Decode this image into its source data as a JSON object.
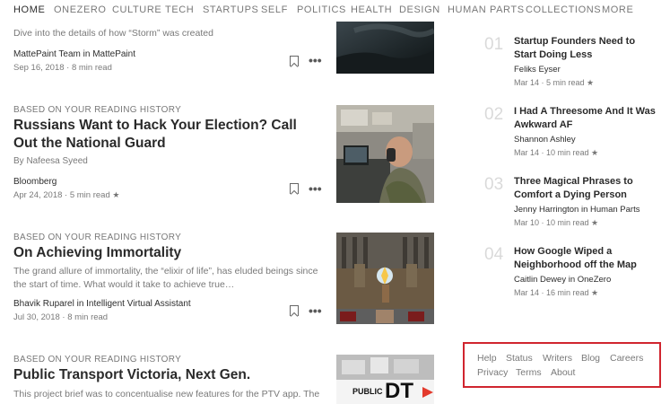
{
  "nav": {
    "items": [
      "HOME",
      "ONEZERO",
      "CULTURE",
      "TECH",
      "STARTUPS",
      "SELF",
      "POLITICS",
      "HEALTH",
      "DESIGN",
      "HUMAN PARTS",
      "COLLECTIONS",
      "MORE"
    ],
    "active": "HOME"
  },
  "feed": {
    "post0": {
      "excerpt": "Dive into the details of how “Storm” was created",
      "publisher": "MattePaint Team in MattePaint",
      "meta": "Sep 16, 2018 · 8 min read"
    },
    "post1": {
      "context": "BASED ON YOUR READING HISTORY",
      "title": "Russians Want to Hack Your Election? Call Out the National Guard",
      "byline": "By Nafeesa Syeed",
      "publisher": "Bloomberg",
      "meta": "Apr 24, 2018 · 5 min read",
      "star": "★"
    },
    "post2": {
      "context": "BASED ON YOUR READING HISTORY",
      "title": "On Achieving Immortality",
      "excerpt": "The grand allure of immortality, the “elixir of life”, has eluded beings since the start of time. What would it take to achieve true…",
      "publisher": "Bhavik Ruparel in Intelligent Virtual Assistant",
      "meta": "Jul 30, 2018 · 8 min read"
    },
    "post3": {
      "context": "BASED ON YOUR READING HISTORY",
      "title": "Public Transport Victoria, Next Gen.",
      "excerpt": "This project brief was to concentualise new features for the PTV app. The",
      "thumb_text_1": "PUBLIC",
      "thumb_text_2": "DT"
    },
    "more_glyph": "•••"
  },
  "popular": [
    {
      "num": "01",
      "title": "Startup Founders Need to Start Doing Less",
      "author": "Feliks Eyser",
      "meta": "Mar 14 · 5 min read ★"
    },
    {
      "num": "02",
      "title": "I Had A Threesome And It Was Awkward AF",
      "author": "Shannon Ashley",
      "meta": "Mar 14 · 10 min read ★"
    },
    {
      "num": "03",
      "title": "Three Magical Phrases to Comfort a Dying Person",
      "author": "Jenny Harrington in Human Parts",
      "meta": "Mar 10 · 10 min read ★"
    },
    {
      "num": "04",
      "title": "How Google Wiped a Neighborhood off the Map",
      "author": "Caitlin Dewey in OneZero",
      "meta": "Mar 14 · 16 min read ★"
    }
  ],
  "footer": {
    "help": "Help",
    "status": "Status",
    "writers": "Writers",
    "blog": "Blog",
    "careers": "Careers",
    "privacy": "Privacy",
    "terms": "Terms",
    "about": "About"
  },
  "colors": {
    "highlight_border": "#d0252f",
    "text_primary": "rgba(0,0,0,0.84)",
    "text_secondary": "rgba(0,0,0,0.54)"
  }
}
